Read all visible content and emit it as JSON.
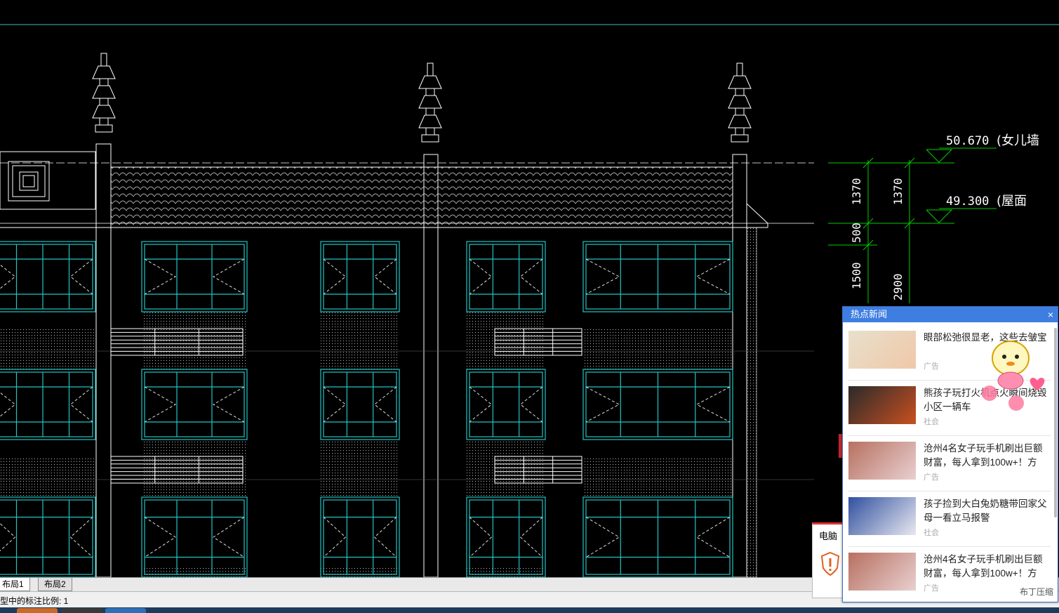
{
  "drawing": {
    "levels": [
      {
        "value": "50.670",
        "label": "女儿墙"
      },
      {
        "value": "49.300",
        "label": "屋面"
      }
    ],
    "dims_inner": [
      "1370",
      "500",
      "1500"
    ],
    "dims_outer": [
      "1370",
      "2900"
    ]
  },
  "tabs": [
    "布局1",
    "布局2"
  ],
  "status": {
    "text": "型中的标注比例: 1"
  },
  "news": {
    "header": "热点新闻",
    "close": "×",
    "items": [
      {
        "title": "眼部松弛很显老，这些去皱宝",
        "tag": "广告"
      },
      {
        "title": "熊孩子玩打火机点火瞬间烧毁小区一辆车",
        "tag": "社会"
      },
      {
        "title": "沧州4名女子玩手机刷出巨额财富，每人拿到100w+！方",
        "tag": "广告"
      },
      {
        "title": "孩子捡到大白兔奶糖带回家父母一看立马报警",
        "tag": "社会"
      },
      {
        "title": "沧州4名女子玩手机刷出巨额财富，每人拿到100w+！方",
        "tag": "广告"
      }
    ],
    "footer": "布丁压缩"
  },
  "alert": {
    "label": "电脑"
  },
  "colors": {
    "window_frame": "#22c4c4",
    "dim_line": "#00cc00",
    "popup_header": "#3e7ee0"
  }
}
